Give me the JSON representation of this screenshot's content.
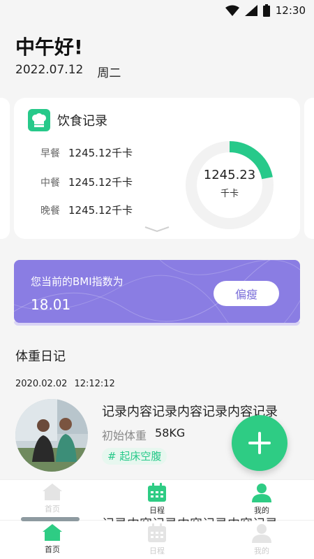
{
  "status_bar": {
    "time": "12:30"
  },
  "header": {
    "greeting": "中午好!",
    "date": "2022.07.12",
    "weekday": "周二"
  },
  "diet_card": {
    "title": "饮食记录",
    "meals": [
      {
        "label": "早餐",
        "value": "1245.12千卡"
      },
      {
        "label": "中餐",
        "value": "1245.12千卡"
      },
      {
        "label": "晚餐",
        "value": "1245.12千卡"
      }
    ],
    "ring_value": "1245.23",
    "ring_unit": "千卡",
    "ring_fraction": 0.22,
    "accent": "#27c98a"
  },
  "bmi_card": {
    "label": "您当前的BMI指数为",
    "value": "18.01",
    "status_button": "偏瘦",
    "color": "#8a7de3"
  },
  "weight_diary": {
    "title": "体重日记",
    "entry": {
      "date": "2020.02.02",
      "time": "12:12:12",
      "text": "记录内容记录内容记录内容记录",
      "weight_label": "初始体重",
      "weight_value": "58KG",
      "tag": "# 起床空腹"
    }
  },
  "tabbar_upper": {
    "tabs": [
      {
        "label": "首页",
        "icon": "home-icon",
        "active": false
      },
      {
        "label": "日程",
        "icon": "calendar-icon",
        "active": true
      },
      {
        "label": "我的",
        "icon": "user-icon",
        "active": true
      }
    ]
  },
  "tabbar_lower": {
    "tabs": [
      {
        "label": "首页",
        "icon": "home-icon",
        "active": true
      },
      {
        "label": "日程",
        "icon": "calendar-icon",
        "active": false
      },
      {
        "label": "我的",
        "icon": "user-icon",
        "active": false
      }
    ]
  },
  "overlap_text": "记录内容记录内容记录内容记录"
}
